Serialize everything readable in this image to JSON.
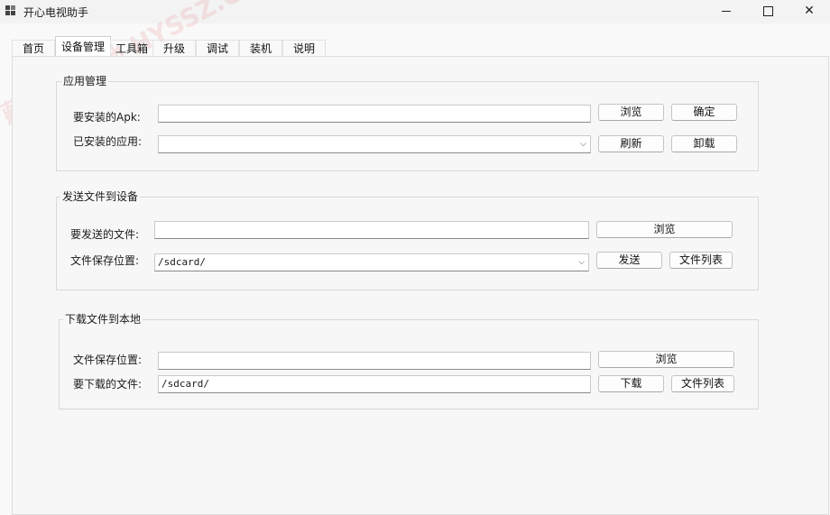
{
  "window": {
    "title": "开心电视助手",
    "icon": "app-icon",
    "controls": {
      "minimize": "minimize-icon",
      "maximize": "maximize-icon",
      "close": "close-icon"
    },
    "close_glyph": "✕"
  },
  "tabs": [
    {
      "label": "首页"
    },
    {
      "label": "设备管理",
      "active": true
    },
    {
      "label": "工具箱"
    },
    {
      "label": "升级"
    },
    {
      "label": "调试"
    },
    {
      "label": "装机"
    },
    {
      "label": "说明"
    }
  ],
  "app_manage": {
    "title": "应用管理",
    "apk_label": "要安装的Apk:",
    "apk_value": "",
    "installed_label": "已安装的应用:",
    "installed_value": "",
    "browse": "浏览",
    "confirm": "确定",
    "refresh": "刷新",
    "uninstall": "卸载"
  },
  "send_file": {
    "title": "发送文件到设备",
    "file_label": "要发送的文件:",
    "file_value": "",
    "save_label": "文件保存位置:",
    "save_value": "/sdcard/",
    "browse": "浏览",
    "send": "发送",
    "file_list": "文件列表"
  },
  "download_file": {
    "title": "下载文件到本地",
    "save_label": "文件保存位置:",
    "save_value": "",
    "file_label": "要下载的文件:",
    "file_value": "/sdcard/",
    "browse": "浏览",
    "download": "下载",
    "file_list": "文件列表"
  },
  "watermark": {
    "text": "藏:黑马基地 HYSSZ.COM"
  },
  "colors": {
    "window_bg": "#f9f9f9",
    "titlebar_bg": "#f3f3f3",
    "watermark": "#e67878"
  }
}
